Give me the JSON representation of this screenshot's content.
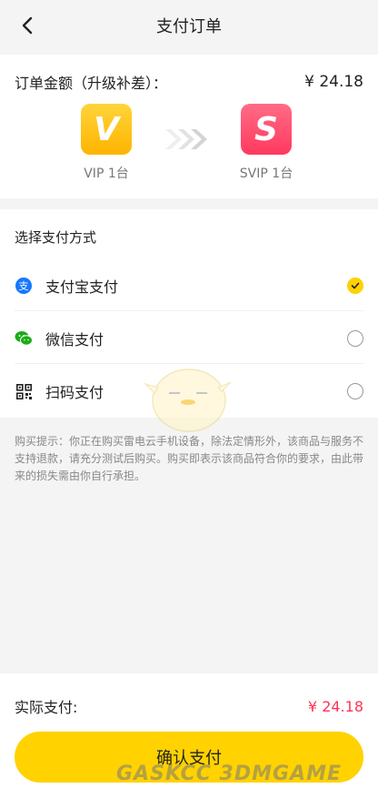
{
  "header": {
    "title": "支付订单"
  },
  "order": {
    "amount_label": "订单金额（升级补差）：",
    "amount_value": "¥ 24.18",
    "from": {
      "badge_letter": "V",
      "label": "VIP 1台",
      "color": "#ffc107"
    },
    "to": {
      "badge_letter": "S",
      "label": "SVIP 1台",
      "color": "#ff4d6d"
    }
  },
  "payment": {
    "title": "选择支付方式",
    "methods": [
      {
        "label": "支付宝支付",
        "icon": "alipay-icon",
        "selected": true
      },
      {
        "label": "微信支付",
        "icon": "wechat-icon",
        "selected": false
      },
      {
        "label": "扫码支付",
        "icon": "qr-code-icon",
        "selected": false
      }
    ]
  },
  "notice": "购买提示：你正在购买雷电云手机设备，除法定情形外，该商品与服务不支持退款，请充分测试后购买。购买即表示该商品符合你的要求，由此带来的损失需由你自行承担。",
  "footer": {
    "actual_label": "实际支付:",
    "actual_value": "¥ 24.18",
    "confirm_label": "确认支付"
  },
  "watermark": "GASKCC 3DMGAME",
  "colors": {
    "accent": "#ffd200",
    "price": "#ff3355"
  }
}
